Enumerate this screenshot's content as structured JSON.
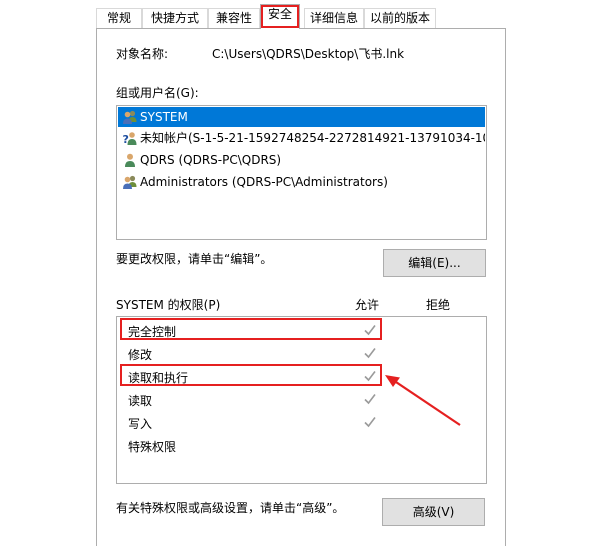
{
  "tabs": [
    {
      "label": "常规"
    },
    {
      "label": "快捷方式"
    },
    {
      "label": "兼容性"
    },
    {
      "label": "安全"
    },
    {
      "label": "详细信息"
    },
    {
      "label": "以前的版本"
    }
  ],
  "object_name": {
    "label": "对象名称:",
    "value": "C:\\Users\\QDRS\\Desktop\\飞书.lnk"
  },
  "groups_label": "组或用户名(G):",
  "users": [
    {
      "name": "SYSTEM",
      "selected": true,
      "icon": "user-group-icon"
    },
    {
      "name": "未知帐户(S-1-5-21-1592748254-2272814921-13791034-10...",
      "selected": false,
      "icon": "unknown-user-icon"
    },
    {
      "name": "QDRS (QDRS-PC\\QDRS)",
      "selected": false,
      "icon": "user-icon"
    },
    {
      "name": "Administrators (QDRS-PC\\Administrators)",
      "selected": false,
      "icon": "user-group-icon"
    }
  ],
  "change_perm_text": "要更改权限，请单击“编辑”。",
  "edit_button": "编辑(E)...",
  "permissions_title": "SYSTEM 的权限(P)",
  "allow_header": "允许",
  "deny_header": "拒绝",
  "permissions": [
    {
      "name": "完全控制",
      "allow": true,
      "deny": false
    },
    {
      "name": "修改",
      "allow": true,
      "deny": false
    },
    {
      "name": "读取和执行",
      "allow": true,
      "deny": false
    },
    {
      "name": "读取",
      "allow": true,
      "deny": false
    },
    {
      "name": "写入",
      "allow": true,
      "deny": false
    },
    {
      "name": "特殊权限",
      "allow": false,
      "deny": false
    }
  ],
  "advanced_text": "有关特殊权限或高级设置，请单击“高级”。",
  "advanced_button": "高级(V)",
  "colors": {
    "highlight": "#e52020",
    "selection": "#0078d7",
    "check": "#9a9a9a"
  }
}
